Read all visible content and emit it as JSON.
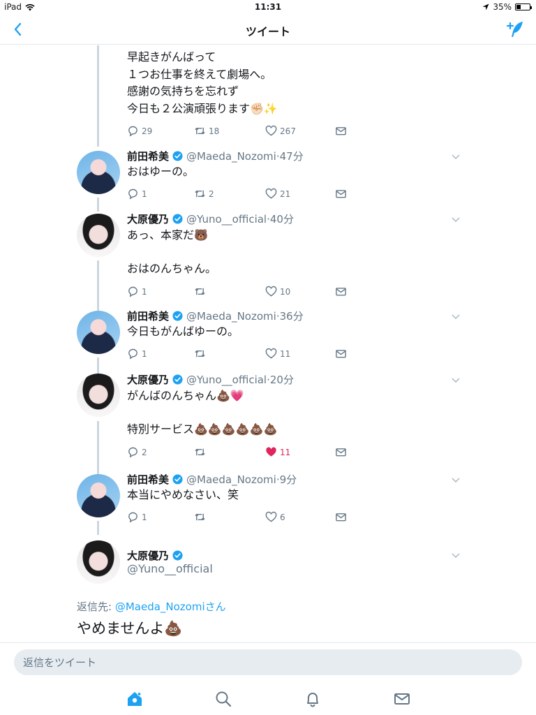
{
  "status_bar": {
    "device": "iPad",
    "time": "11:31",
    "battery": "35%",
    "battery_level": 0.35
  },
  "nav": {
    "title": "ツイート"
  },
  "tweets": [
    {
      "lines": "早起きがんばって\n１つお仕事を終えて劇場へ。\n感謝の気持ちを忘れず\n今日も２公演頑張ります✊🏻✨",
      "replies": "29",
      "retweets": "18",
      "likes": "267"
    },
    {
      "name": "前田希美",
      "handle": "@Maeda_Nozomi",
      "time": "47分",
      "text": "おはゆーの。",
      "replies": "1",
      "retweets": "2",
      "likes": "21"
    },
    {
      "name": "大原優乃",
      "handle": "@Yuno__official",
      "time": "40分",
      "text": "あっ、本家だ🐻\n\nおはのんちゃん。",
      "replies": "1",
      "retweets": "",
      "likes": "10"
    },
    {
      "name": "前田希美",
      "handle": "@Maeda_Nozomi",
      "time": "36分",
      "text": "今日もがんばゆーの。",
      "replies": "1",
      "retweets": "",
      "likes": "11"
    },
    {
      "name": "大原優乃",
      "handle": "@Yuno__official",
      "time": "20分",
      "text": "がんばのんちゃん💩💗\n\n特別サービス💩💩💩💩💩💩",
      "replies": "2",
      "retweets": "",
      "likes": "11"
    },
    {
      "name": "前田希美",
      "handle": "@Maeda_Nozomi",
      "time": "9分",
      "text": "本当にやめなさい、笑",
      "replies": "1",
      "retweets": "",
      "likes": "6"
    }
  ],
  "focused": {
    "name": "大原優乃",
    "handle": "@Yuno__official",
    "reply_prefix": "返信先: ",
    "reply_mention": "@Maeda_Nozomiさん",
    "text": "やめませんよ💩"
  },
  "reply_bar": {
    "placeholder": "返信をツイート"
  },
  "colors": {
    "accent": "#1da1f2",
    "like": "#e0245e",
    "muted": "#657786",
    "divider": "#e1e8ed"
  },
  "tabs": [
    "home-icon",
    "search-icon",
    "notifications-icon",
    "messages-icon"
  ]
}
